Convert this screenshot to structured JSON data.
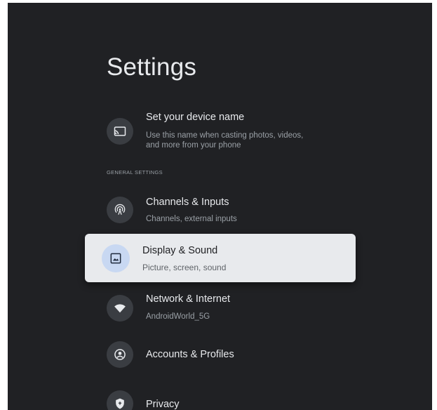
{
  "page": {
    "title": "Settings"
  },
  "device_name": {
    "title": "Set your device name",
    "subtitle_line1": "Use this name when casting photos, videos,",
    "subtitle_line2": "and more from your phone",
    "icon": "cast-icon"
  },
  "section": {
    "label": "GENERAL SETTINGS"
  },
  "items": [
    {
      "title": "Channels & Inputs",
      "subtitle": "Channels, external inputs",
      "icon": "antenna-icon"
    },
    {
      "title": "Display & Sound",
      "subtitle": "Picture, screen, sound",
      "icon": "image-icon",
      "focused": true
    },
    {
      "title": "Network & Internet",
      "subtitle": "AndroidWorld_5G",
      "icon": "wifi-icon"
    },
    {
      "title": "Accounts & Profiles",
      "subtitle": "",
      "icon": "account-icon"
    },
    {
      "title": "Privacy",
      "subtitle": "",
      "icon": "shield-icon"
    }
  ],
  "colors": {
    "background": "#202124",
    "focused_card": "#e8eaed",
    "icon_circle": "#3a3d42",
    "focused_icon_circle": "#c8d8f2",
    "text_primary": "#e8eaed",
    "text_secondary": "#9aa0a6"
  }
}
